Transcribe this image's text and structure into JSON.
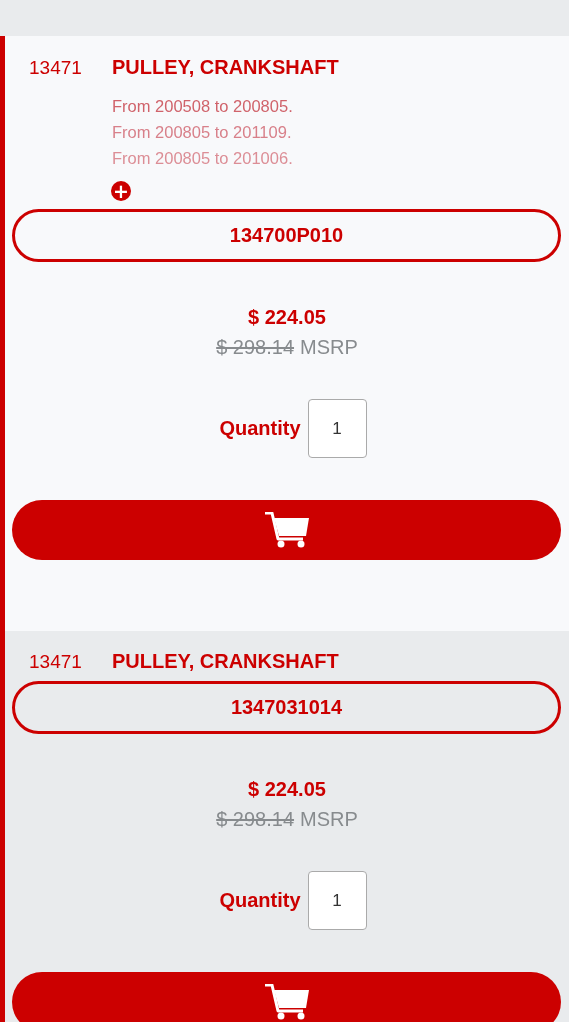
{
  "parts": [
    {
      "ref": "13471",
      "name": "PULLEY, CRANKSHAFT",
      "notes": [
        "From 200508 to 200805.",
        "From 200805 to 201109.",
        "From 200805 to 201006."
      ],
      "expand_icon": "+",
      "part_number": "134700P010",
      "price": "$ 224.05",
      "list_price": "$ 298.14",
      "list_price_label": "MSRP",
      "quantity_label": "Quantity",
      "quantity": "1"
    },
    {
      "ref": "13471",
      "name": "PULLEY, CRANKSHAFT",
      "part_number": "1347031014",
      "price": "$ 224.05",
      "list_price": "$ 298.14",
      "list_price_label": "MSRP",
      "quantity_label": "Quantity",
      "quantity": "1"
    }
  ]
}
